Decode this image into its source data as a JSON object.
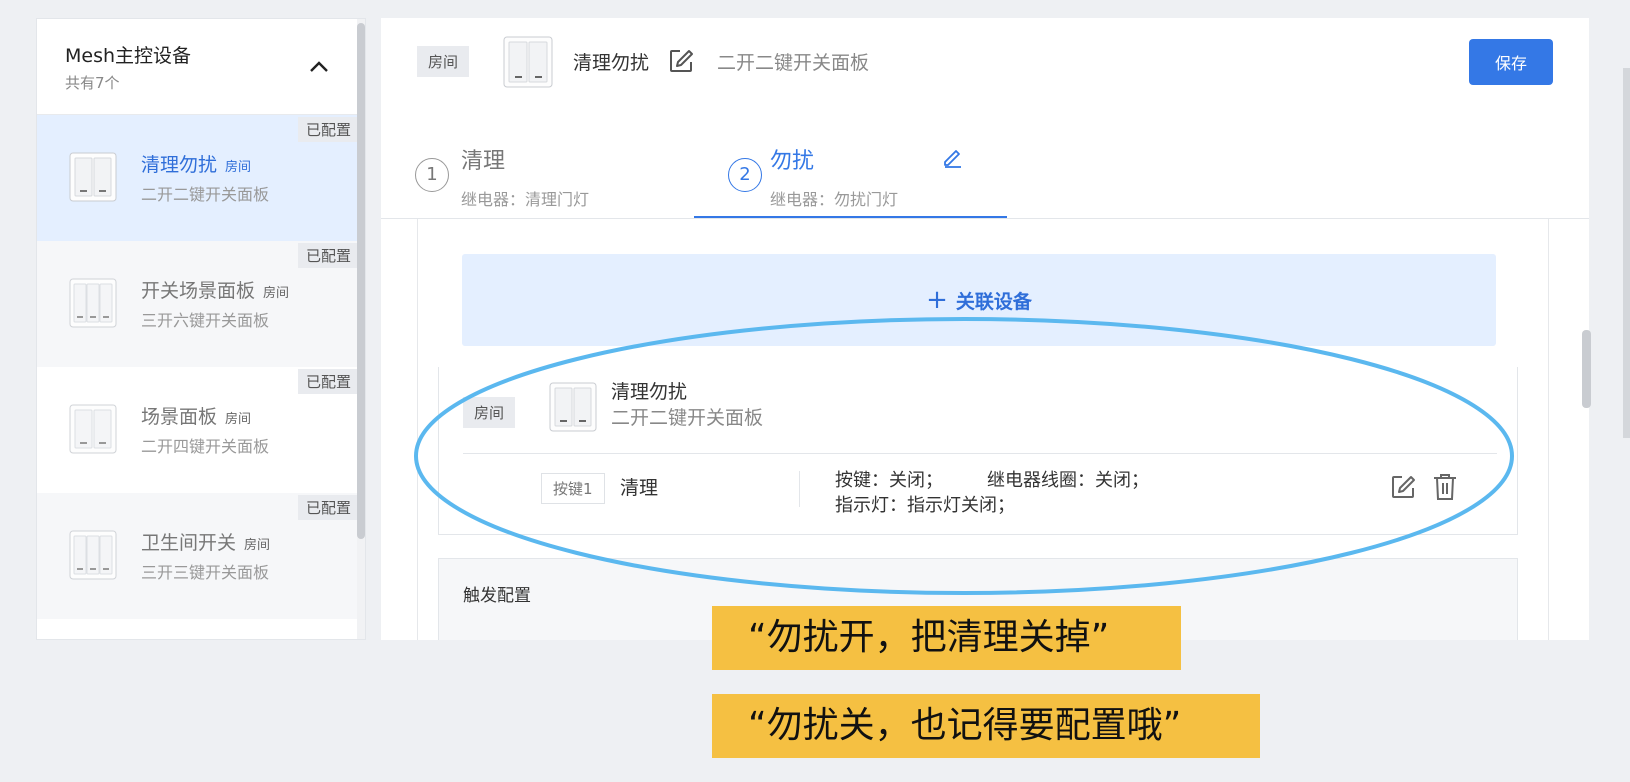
{
  "sidebar": {
    "title": "Mesh主控设备",
    "subtitle": "共有7个",
    "items": [
      {
        "name": "清理勿扰",
        "tag": "房间",
        "desc": "二开二键开关面板",
        "badge": "已配置",
        "keys": 2,
        "active": true
      },
      {
        "name": "开关场景面板",
        "tag": "房间",
        "desc": "三开六键开关面板",
        "badge": "已配置",
        "keys": 3,
        "active": false
      },
      {
        "name": "场景面板",
        "tag": "房间",
        "desc": "二开四键开关面板",
        "badge": "已配置",
        "keys": 2,
        "active": false
      },
      {
        "name": "卫生间开关",
        "tag": "房间",
        "desc": "三开三键开关面板",
        "badge": "已配置",
        "keys": 3,
        "active": false
      }
    ]
  },
  "header": {
    "room_tag": "房间",
    "device_name": "清理勿扰",
    "device_model": "二开二键开关面板",
    "save_label": "保存"
  },
  "steps": [
    {
      "num": "1",
      "title": "清理",
      "sub": "继电器：清理门灯",
      "active": false
    },
    {
      "num": "2",
      "title": "勿扰",
      "sub": "继电器：勿扰门灯",
      "active": true
    }
  ],
  "content": {
    "link_device_label": "关联设备",
    "linked_device": {
      "room_tag": "房间",
      "name": "清理勿扰",
      "model": "二开二键开关面板"
    },
    "binding": {
      "key_tag": "按键1",
      "key_name": "清理",
      "config_line1_a": "按键：关闭；",
      "config_line1_b": "继电器线圈：关闭；",
      "config_line2": "指示灯：指示灯关闭；"
    },
    "trigger_title": "触发配置"
  },
  "captions": [
    "“勿扰开，把清理关掉”",
    "“勿扰关，也记得要配置哦”"
  ],
  "colors": {
    "accent": "#3478e6",
    "active_bg": "#e4efff",
    "highlight_ellipse": "#5bb8ef",
    "caption_bg": "#f5c042"
  }
}
